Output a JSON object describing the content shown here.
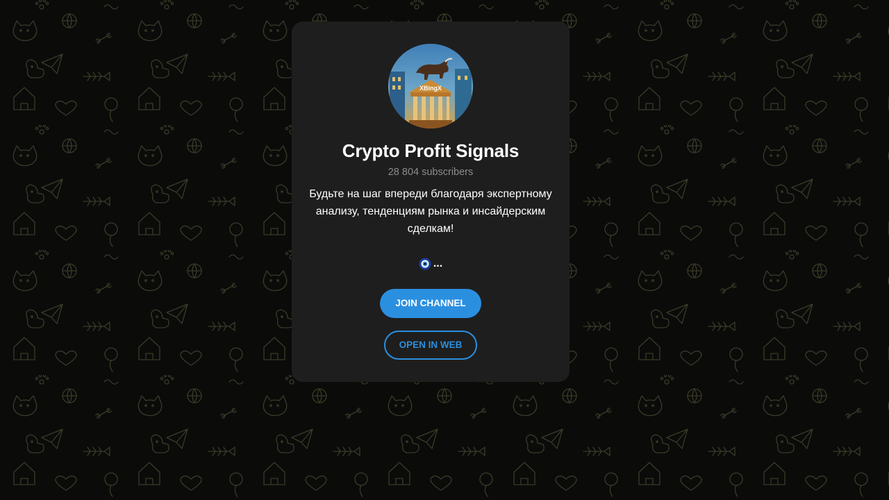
{
  "channel": {
    "title": "Crypto Profit Signals",
    "subscribers": "28 804 subscribers",
    "description": "Будьте на шаг впереди благодаря экспертному анализу, тенденциям рынка и инсайдерским сделкам!",
    "more": "...",
    "avatar_text": "XBingX"
  },
  "actions": {
    "join_label": "JOIN CHANNEL",
    "web_label": "OPEN IN WEB"
  },
  "colors": {
    "background": "#0b0b0a",
    "pattern": "#3a3a28",
    "card": "#1e1e1e",
    "accent": "#2b8fe0",
    "muted_text": "#8c8c8c"
  },
  "icons": {
    "emoji": "nazar-amulet-icon"
  }
}
